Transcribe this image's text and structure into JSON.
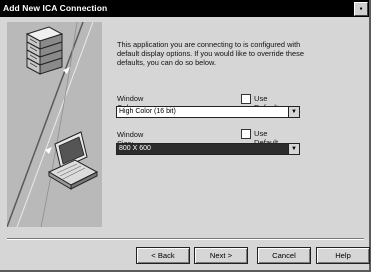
{
  "window": {
    "title": "Add New ICA Connection"
  },
  "description": "This application you are connecting to is configured with default display options.  If you would like to override these defaults, you can do so below.",
  "colors": {
    "label": "Window Colors:",
    "use_default_label": "Use Default",
    "value": "High Color (16 bit)"
  },
  "size": {
    "label": "Window Size:",
    "use_default_label": "Use Default",
    "value": "800 X 600"
  },
  "buttons": {
    "back": "< Back",
    "next": "Next >",
    "cancel": "Cancel",
    "help": "Help"
  },
  "icons": {
    "dropdown": "dropdown-arrow-icon",
    "server": "server-stack-icon",
    "laptop": "laptop-icon"
  }
}
